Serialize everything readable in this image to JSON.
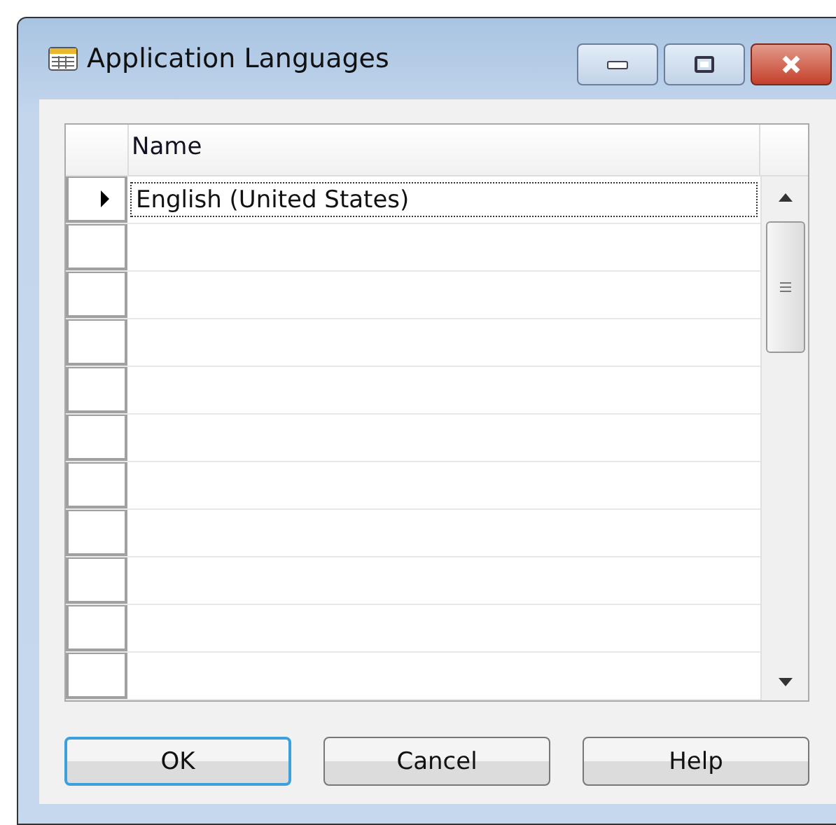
{
  "window": {
    "title": "Application Languages"
  },
  "table": {
    "columns": [
      "Name"
    ],
    "rows": [
      {
        "name": "English (United States)",
        "selected": true
      }
    ]
  },
  "buttons": [
    {
      "label": "OK",
      "focused": true
    },
    {
      "label": "Cancel",
      "focused": false
    },
    {
      "label": "Help",
      "focused": false
    }
  ]
}
